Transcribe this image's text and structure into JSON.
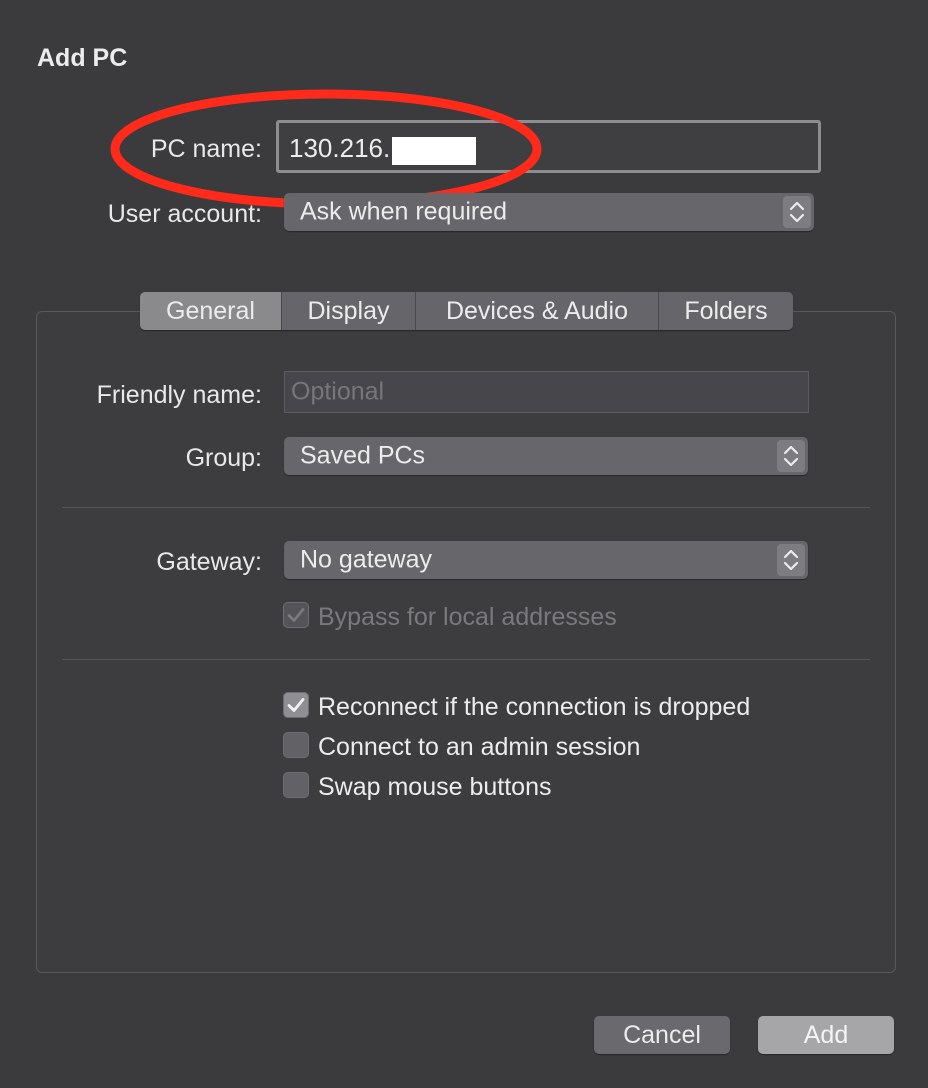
{
  "dialog": {
    "title": "Add PC"
  },
  "pc_name": {
    "label": "PC name:",
    "value": "130.216."
  },
  "user_account": {
    "label": "User account:",
    "selected": "Ask when required"
  },
  "tabs": [
    {
      "label": "General",
      "selected": true
    },
    {
      "label": "Display",
      "selected": false
    },
    {
      "label": "Devices & Audio",
      "selected": false
    },
    {
      "label": "Folders",
      "selected": false
    }
  ],
  "general": {
    "friendly_name": {
      "label": "Friendly name:",
      "value": "",
      "placeholder": "Optional"
    },
    "group": {
      "label": "Group:",
      "selected": "Saved PCs"
    },
    "gateway": {
      "label": "Gateway:",
      "selected": "No gateway"
    },
    "bypass": {
      "label": "Bypass for local addresses",
      "checked": true,
      "enabled": false
    },
    "options": [
      {
        "label": "Reconnect if the connection is dropped",
        "checked": true
      },
      {
        "label": "Connect to an admin session",
        "checked": false
      },
      {
        "label": "Swap mouse buttons",
        "checked": false
      }
    ]
  },
  "buttons": {
    "cancel": "Cancel",
    "add": "Add"
  },
  "colors": {
    "annotation_ring": "#ff2a1a",
    "background": "#3b3a3d"
  }
}
